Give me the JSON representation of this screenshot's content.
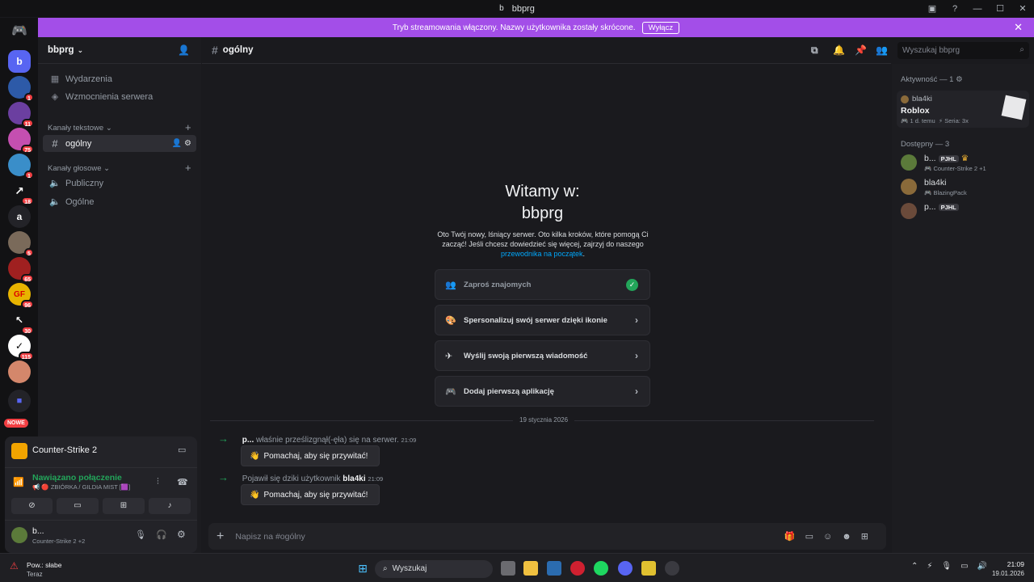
{
  "window": {
    "title": "bbprg"
  },
  "banner": {
    "text": "Tryb streamowania włączony. Nazwy użytkownika zostały skrócone.",
    "button": "Wyłącz"
  },
  "guilds": [
    {
      "label": "b",
      "badge": ""
    },
    {
      "label": "",
      "badge": "1"
    },
    {
      "label": "",
      "badge": "11"
    },
    {
      "label": "",
      "badge": "75"
    },
    {
      "label": "",
      "badge": "1"
    },
    {
      "label": "",
      "badge": "18"
    },
    {
      "label": "a",
      "badge": ""
    },
    {
      "label": "",
      "badge": "5"
    },
    {
      "label": "",
      "badge": "65"
    },
    {
      "label": "",
      "badge": "96"
    },
    {
      "label": "",
      "badge": "30"
    },
    {
      "label": "",
      "badge": "115"
    },
    {
      "label": "",
      "badge": ""
    },
    {
      "label": "",
      "badge": ""
    }
  ],
  "new_badge": "NOWE",
  "server": {
    "name": "bbprg",
    "events": "Wydarzenia",
    "boosts": "Wzmocnienia serwera",
    "text_category": "Kanały tekstowe",
    "text_channel": "ogólny",
    "voice_category": "Kanały głosowe",
    "voice_channels": [
      "Publiczny",
      "Ogólne"
    ]
  },
  "activity_panel": {
    "game": "Counter-Strike 2",
    "voice_status": "Nawiązano połączenie",
    "voice_channel": "📢 🔴 ZBIÓRKA / GILDIA MIST [🟪]",
    "user_name": "b...",
    "user_status": "Counter-Strike 2 +2"
  },
  "chat": {
    "channel": "ogólny",
    "search_placeholder": "Wyszukaj bbprg",
    "welcome_line1": "Witamy w:",
    "welcome_line2": "bbprg",
    "intro": "Oto Twój nowy, lśniący serwer. Oto kilka kroków, które pomogą Ci zacząć! Jeśli chcesz dowiedzieć się więcej, zajrzyj do naszego",
    "intro_link": "przewodnika na początek",
    "steps": [
      "Zaproś znajomych",
      "Spersonalizuj swój serwer dzięki ikonie",
      "Wyślij swoją pierwszą wiadomość",
      "Dodaj pierwszą aplikację"
    ],
    "date_divider": "19 stycznia 2026",
    "messages": [
      {
        "user": "p...",
        "text": "właśnie prześlizgnął(-ęła) się na serwer.",
        "time": "21:09",
        "button": "Pomachaj, aby się przywitać!"
      },
      {
        "user": "bla4ki",
        "prefix": "Pojawił się dziki użytkownik",
        "time": "21:09",
        "button": "Pomachaj, aby się przywitać!"
      }
    ],
    "input_placeholder": "Napisz na #ogólny"
  },
  "members": {
    "activity_header": "Aktywność — 1",
    "activity_user": "bla4ki",
    "activity_game": "Roblox",
    "activity_time": "1 d. temu",
    "activity_streak": "Seria: 3x",
    "online_header": "Dostępny — 3",
    "list": [
      {
        "name": "b...",
        "tag": "PJHL",
        "status": "Counter-Strike 2 +1"
      },
      {
        "name": "bla4ki",
        "tag": "",
        "status": "BlazingPack"
      },
      {
        "name": "p...",
        "tag": "PJHL",
        "status": ""
      }
    ]
  },
  "taskbar": {
    "weather_title": "Pow.: słabe",
    "weather_sub": "Teraz",
    "search": "Wyszukaj",
    "time": "21:09",
    "date": "19.01.2026"
  }
}
